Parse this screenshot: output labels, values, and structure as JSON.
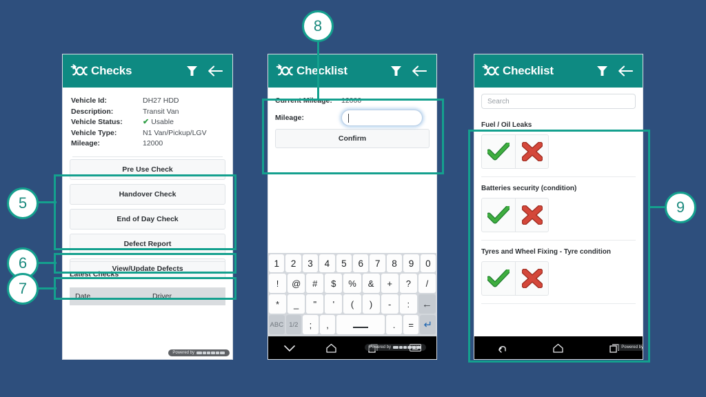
{
  "theme": {
    "background": "#2e4f7d",
    "header_teal": "#0e8a82",
    "annotation_green": "#14a08e",
    "bubble_text": "#1b8a7e",
    "check_green": "#2f9e44",
    "cross_red": "#d4473a"
  },
  "watermark": {
    "text": "Powered by"
  },
  "screen1": {
    "header": {
      "title": "Checks",
      "filter_icon": "filter-icon",
      "back_icon": "back-arrow-icon",
      "logo_icon": "app-logo-icon"
    },
    "info": [
      {
        "label": "Vehicle Id:",
        "value": "DH27 HDD",
        "status": false
      },
      {
        "label": "Description:",
        "value": "Transit Van",
        "status": false
      },
      {
        "label": "Vehicle Status:",
        "value": "Usable",
        "status": true,
        "check": "✔"
      },
      {
        "label": "Vehicle Type:",
        "value": "N1 Van/Pickup/LGV",
        "status": false
      },
      {
        "label": "Mileage:",
        "value": "12000",
        "status": false
      }
    ],
    "buttons": [
      "Pre Use Check",
      "Handover Check",
      "End of Day Check",
      "Defect Report",
      "View/Update Defects"
    ],
    "latest_checks_title": "Latest Checks",
    "table_headers": [
      "Date",
      "Driver"
    ]
  },
  "screen2": {
    "header": {
      "title": "Checklist",
      "filter_icon": "filter-icon",
      "back_icon": "back-arrow-icon",
      "logo_icon": "app-logo-icon"
    },
    "form": {
      "current_mileage_label": "Current Mileage:",
      "current_mileage_value": "12000",
      "mileage_label": "Mileage:",
      "mileage_value": "",
      "confirm_label": "Confirm"
    },
    "keyboard": {
      "row1": [
        "1",
        "2",
        "3",
        "4",
        "5",
        "6",
        "7",
        "8",
        "9",
        "0"
      ],
      "row2": [
        "!",
        "@",
        "#",
        "$",
        "%",
        "&",
        "+",
        "?",
        "/"
      ],
      "row3": [
        "*",
        "_",
        "\"",
        "'",
        "(",
        ")",
        "-",
        ":"
      ],
      "row3_end": "←",
      "row4": [
        "ABC",
        "1/2",
        ";",
        ",",
        "space",
        ".",
        "=",
        "↵"
      ]
    },
    "navbar": [
      "chevron-down-icon",
      "home-icon",
      "recents-icon",
      "keyboard-icon"
    ]
  },
  "screen3": {
    "header": {
      "title": "Checklist",
      "filter_icon": "filter-icon",
      "back_icon": "back-arrow-icon",
      "logo_icon": "app-logo-icon"
    },
    "search_placeholder": "Search",
    "items": [
      {
        "label": "Fuel / Oil Leaks",
        "pass_icon": "green-check-icon",
        "fail_icon": "red-cross-icon"
      },
      {
        "label": "Batteries security (condition)",
        "pass_icon": "green-check-icon",
        "fail_icon": "red-cross-icon"
      },
      {
        "label": "Tyres and Wheel Fixing - Tyre condition",
        "pass_icon": "green-check-icon",
        "fail_icon": "red-cross-icon"
      }
    ],
    "navbar": [
      "back-icon",
      "home-icon",
      "recents-icon"
    ]
  },
  "callouts": [
    {
      "number": "5"
    },
    {
      "number": "6"
    },
    {
      "number": "7"
    },
    {
      "number": "8"
    },
    {
      "number": "9"
    }
  ]
}
